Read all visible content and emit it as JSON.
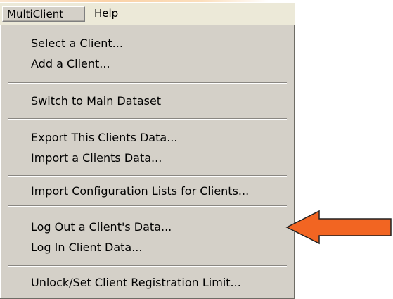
{
  "menubar": {
    "items": [
      {
        "label": "MultiClient"
      },
      {
        "label": "Help"
      }
    ]
  },
  "dropdown": {
    "items": [
      {
        "label": "Select a Client..."
      },
      {
        "label": "Add a Client..."
      },
      {
        "label": "Switch to Main Dataset"
      },
      {
        "label": "Export This Clients Data..."
      },
      {
        "label": "Import a Clients Data..."
      },
      {
        "label": "Import Configuration Lists for Clients..."
      },
      {
        "label": "Log Out a Client's Data..."
      },
      {
        "label": "Log In Client Data..."
      },
      {
        "label": "Unlock/Set Client Registration Limit..."
      }
    ]
  },
  "annotation": {
    "arrow_color": "#f26522",
    "arrow_outline": "#222222",
    "points_to": "Log Out a Client's Data..."
  }
}
